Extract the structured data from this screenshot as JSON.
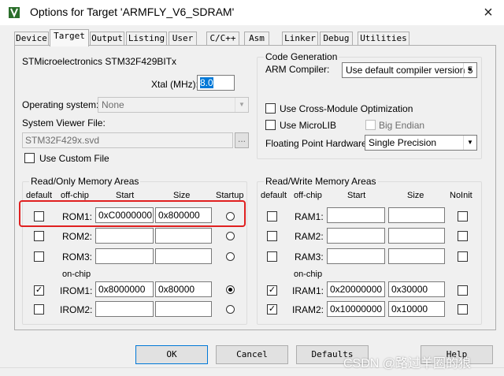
{
  "window": {
    "title": "Options for Target 'ARMFLY_V6_SDRAM'",
    "close": "×"
  },
  "tabs": [
    "Device",
    "Target",
    "Output",
    "Listing",
    "User",
    "C/C++",
    "Asm",
    "Linker",
    "Debug",
    "Utilities"
  ],
  "target": {
    "device_name": "STMicroelectronics STM32F429BITx",
    "xtal_label": "Xtal (MHz):",
    "xtal_value": "8.0",
    "os_label": "Operating system:",
    "os_value": "None",
    "svd_label": "System Viewer File:",
    "svd_value": "STM32F429x.svd",
    "browse": "...",
    "custom_file_label": "Use Custom File"
  },
  "codegen": {
    "title": "Code Generation",
    "compiler_label": "ARM Compiler:",
    "compiler_value": "Use default compiler version 5",
    "cross_module_label": "Use Cross-Module Optimization",
    "microlib_label": "Use MicroLIB",
    "big_endian_label": "Big Endian",
    "fpu_label": "Floating Point Hardware:",
    "fpu_value": "Single Precision"
  },
  "rom": {
    "title": "Read/Only Memory Areas",
    "headers": {
      "default": "default",
      "offchip": "off-chip",
      "start": "Start",
      "size": "Size",
      "startup": "Startup"
    },
    "onchip_label": "on-chip",
    "rows": [
      {
        "name": "ROM1:",
        "start": "0xC0000000",
        "size": "0x800000",
        "default": false,
        "startup": false
      },
      {
        "name": "ROM2:",
        "start": "",
        "size": "",
        "default": false,
        "startup": false
      },
      {
        "name": "ROM3:",
        "start": "",
        "size": "",
        "default": false,
        "startup": false
      },
      {
        "name": "IROM1:",
        "start": "0x8000000",
        "size": "0x80000",
        "default": true,
        "startup": true
      },
      {
        "name": "IROM2:",
        "start": "",
        "size": "",
        "default": false,
        "startup": false
      }
    ]
  },
  "ram": {
    "title": "Read/Write Memory Areas",
    "headers": {
      "default": "default",
      "offchip": "off-chip",
      "start": "Start",
      "size": "Size",
      "noinit": "NoInit"
    },
    "onchip_label": "on-chip",
    "rows": [
      {
        "name": "RAM1:",
        "start": "",
        "size": "",
        "default": false
      },
      {
        "name": "RAM2:",
        "start": "",
        "size": "",
        "default": false
      },
      {
        "name": "RAM3:",
        "start": "",
        "size": "",
        "default": false
      },
      {
        "name": "IRAM1:",
        "start": "0x20000000",
        "size": "0x30000",
        "default": true
      },
      {
        "name": "IRAM2:",
        "start": "0x10000000",
        "size": "0x10000",
        "default": true
      }
    ]
  },
  "buttons": {
    "ok": "OK",
    "cancel": "Cancel",
    "defaults": "Defaults",
    "help": "Help"
  },
  "watermark": "CSDN @路过羊圈的狼",
  "colors": {
    "highlight": "#e02020",
    "selection": "#0078d7"
  }
}
